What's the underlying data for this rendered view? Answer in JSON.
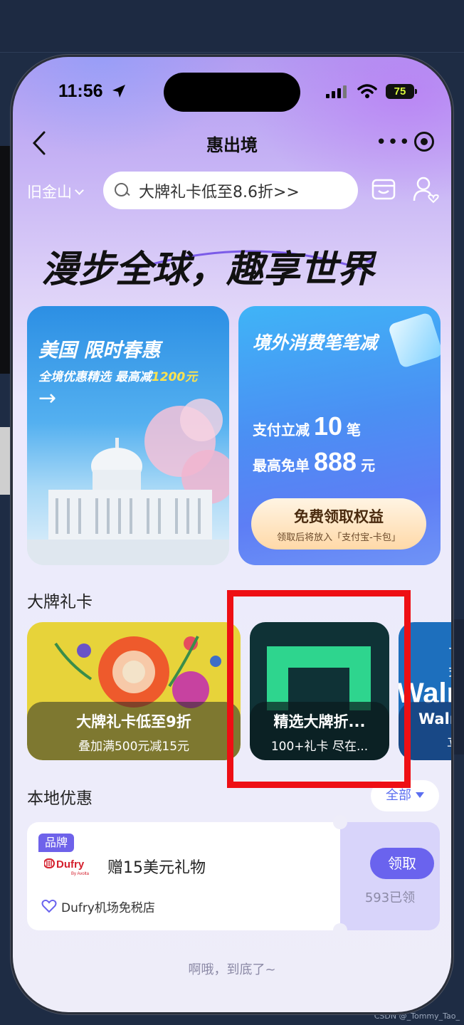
{
  "watermark": "CSDN @_Tommy_Tao_",
  "status_bar": {
    "time": "11:56",
    "battery": "75"
  },
  "nav": {
    "title": "惠出境"
  },
  "header": {
    "city": "旧金山",
    "search_placeholder": "大牌礼卡低至8.6折>>"
  },
  "slogan": "漫步全球，趣享世界",
  "promo_left": {
    "title": "美国 限时春惠",
    "subtitle_prefix": "全境优惠精选 最高减",
    "subtitle_amount": "1200元",
    "arrow": "→"
  },
  "promo_right": {
    "title": "境外消费笔笔减",
    "line1_prefix": "支付立减",
    "line1_value": "10",
    "line1_suffix": "笔",
    "line2_prefix": "最高免单",
    "line2_value": "888",
    "line2_suffix": "元",
    "button_label": "免费领取权益",
    "button_sub": "领取后将放入「支付宝-卡包」"
  },
  "gift_section": {
    "title": "大牌礼卡",
    "cards": [
      {
        "title": "大牌礼卡低至9折",
        "subtitle": "叠加满500元减15元"
      },
      {
        "title": "精选大牌折...",
        "subtitle": "100+礼卡 尽在..."
      },
      {
        "brand_text": "Walm",
        "title": "Walm",
        "subtitle": "立",
        "top_text": "丁式"
      }
    ]
  },
  "local_section": {
    "title": "本地优惠",
    "filter_label": "全部",
    "coupon": {
      "badge": "品牌",
      "logo_text": "Dufry",
      "logo_sub": "By Avolta",
      "title": "赠15美元礼物",
      "store": "Dufry机场免税店",
      "button": "领取",
      "claimed": "593已领"
    }
  },
  "footer": "啊哦，到底了~",
  "colors": {
    "accent": "#6a63ee",
    "highlight": "#ee0f14",
    "promo_gold": "#ffe34d"
  }
}
